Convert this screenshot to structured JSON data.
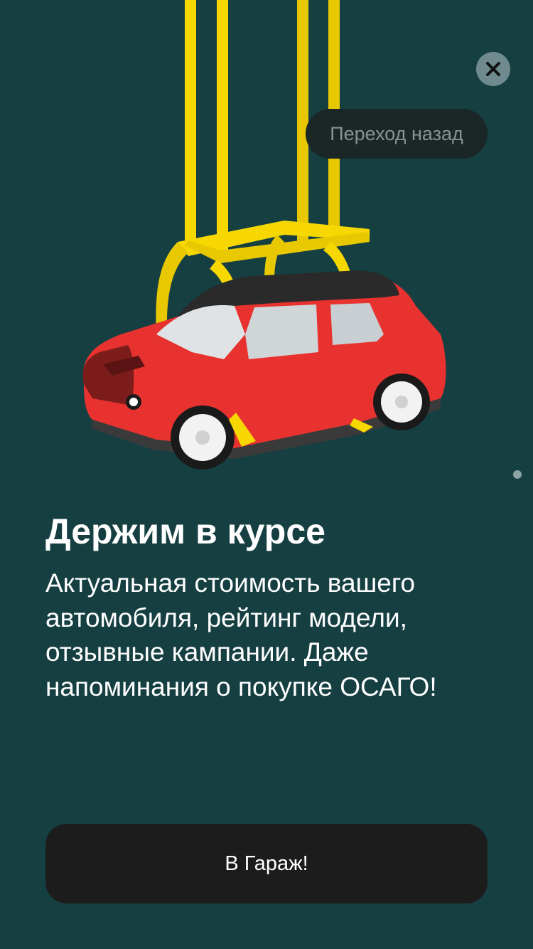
{
  "navigation": {
    "close_icon": "close-icon",
    "back_label": "Переход назад"
  },
  "illustration": {
    "subject": "red car lifted by yellow crane frame",
    "car_color": "#e8322f",
    "frame_color": "#f6d800"
  },
  "pager": {
    "current": 1
  },
  "content": {
    "title": "Держим в курсе",
    "description_lines": [
      "Актуальная стоимость вашего",
      "автомобиля, рейтинг модели,",
      "отзывные кампании. Даже",
      "напоминания о покупке ОСАГО!"
    ]
  },
  "cta": {
    "label": "В Гараж!"
  },
  "colors": {
    "background": "#163f42",
    "button": "#1c1c1d",
    "text": "#ffffff"
  }
}
